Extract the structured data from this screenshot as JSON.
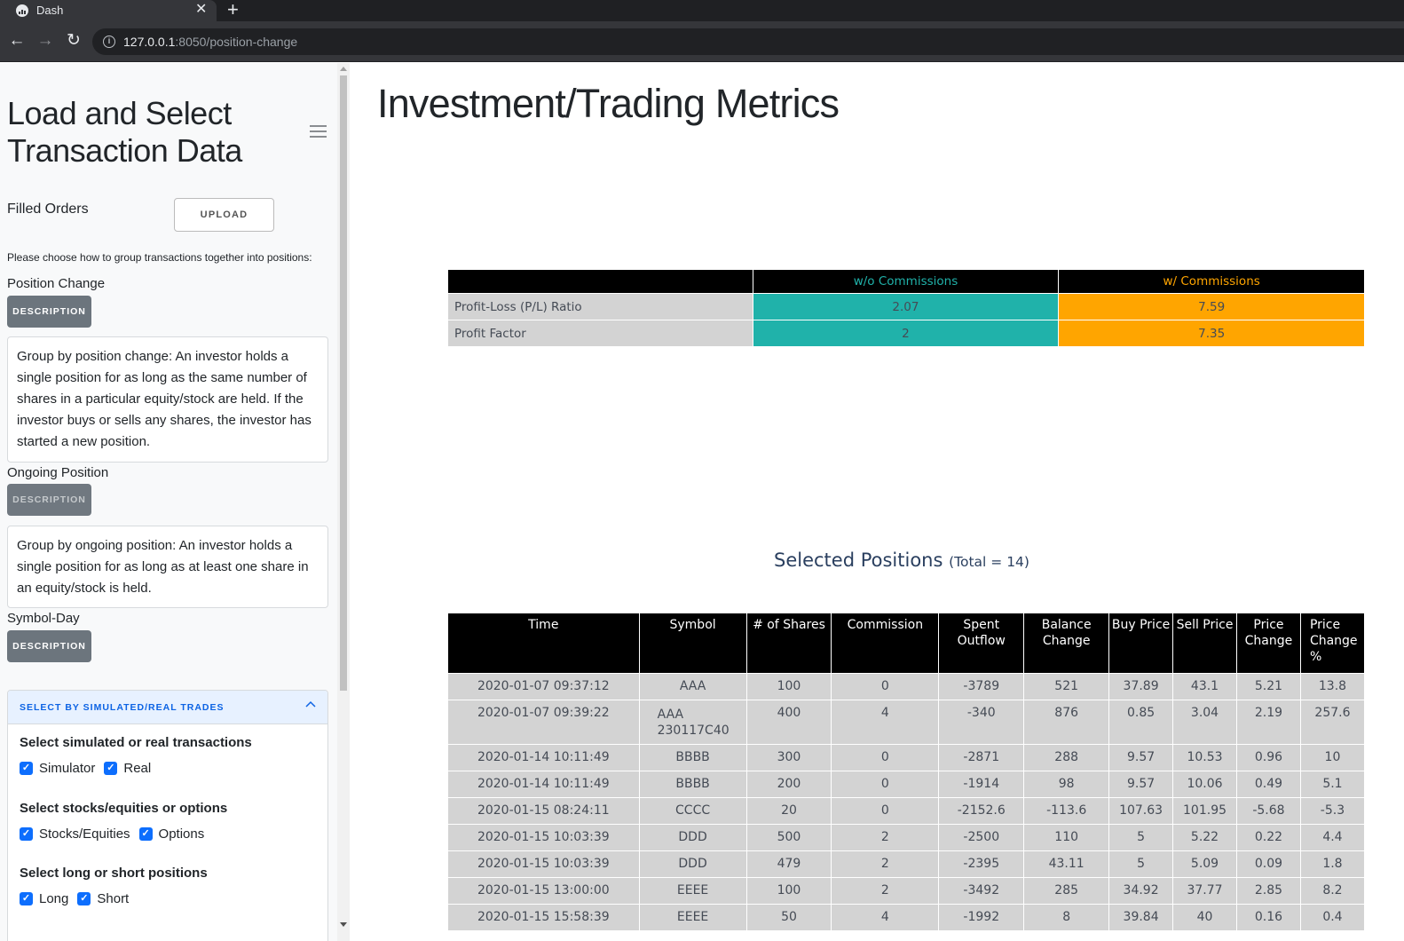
{
  "browser": {
    "tab_title": "Dash",
    "new_tab_symbol": "+",
    "close_symbol": "✕",
    "url_host": "127.0.0.1",
    "url_rest": ":8050/position-change"
  },
  "sidebar": {
    "title": "Load and Select Transaction Data",
    "filled_orders_label": "Filled Orders",
    "upload_label": "UPLOAD",
    "group_prompt": "Please choose how to group transactions together into positions:",
    "options": [
      {
        "label": "Position Change",
        "button": "DESCRIPTION",
        "description": "Group by position change: An investor holds a single position for as long as the same number of shares in a particular equity/stock are held. If the investor buys or sells any shares, the investor has started a new position."
      },
      {
        "label": "Ongoing Position",
        "button": "DESCRIPTION",
        "description": "Group by ongoing position: An investor holds a single position for as long as at least one share in an equity/stock is held."
      },
      {
        "label": "Symbol-Day",
        "button": "DESCRIPTION"
      }
    ],
    "accordion": {
      "title": "SELECT BY SIMULATED/REAL TRADES",
      "sections": [
        {
          "title": "Select simulated or real transactions",
          "checkboxes": [
            {
              "label": "Simulator",
              "checked": true
            },
            {
              "label": "Real",
              "checked": true
            }
          ]
        },
        {
          "title": "Select stocks/equities or options",
          "checkboxes": [
            {
              "label": "Stocks/Equities",
              "checked": true
            },
            {
              "label": "Options",
              "checked": true
            }
          ]
        },
        {
          "title": "Select long or short positions",
          "checkboxes": [
            {
              "label": "Long",
              "checked": true
            },
            {
              "label": "Short",
              "checked": true
            }
          ]
        }
      ]
    }
  },
  "main": {
    "title": "Investment/Trading Metrics",
    "metrics_table": {
      "headers": [
        "",
        "w/o Commissions",
        "w/ Commissions"
      ],
      "rows": [
        [
          "Profit-Loss (P/L) Ratio",
          "2.07",
          "7.59"
        ],
        [
          "Profit Factor",
          "2",
          "7.35"
        ]
      ],
      "colors": {
        "without": "#20b2aa",
        "with": "#ffa500"
      }
    },
    "selected_title": "Selected Positions",
    "selected_total": "(Total = 14)",
    "positions_table": {
      "headers": [
        "Time",
        "Symbol",
        "# of Shares",
        "Commission",
        "Spent Outflow",
        "Balance Change",
        "Buy Price",
        "Sell Price",
        "Price Change",
        "Price Change %"
      ],
      "rows": [
        [
          "2020-01-07 09:37:12",
          "AAA",
          "100",
          "0",
          "-3789",
          "521",
          "37.89",
          "43.1",
          "5.21",
          "13.8"
        ],
        [
          "2020-01-07 09:39:22",
          "AAA 230117C40",
          "400",
          "4",
          "-340",
          "876",
          "0.85",
          "3.04",
          "2.19",
          "257.6"
        ],
        [
          "2020-01-14 10:11:49",
          "BBBB",
          "300",
          "0",
          "-2871",
          "288",
          "9.57",
          "10.53",
          "0.96",
          "10"
        ],
        [
          "2020-01-14 10:11:49",
          "BBBB",
          "200",
          "0",
          "-1914",
          "98",
          "9.57",
          "10.06",
          "0.49",
          "5.1"
        ],
        [
          "2020-01-15 08:24:11",
          "CCCC",
          "20",
          "0",
          "-2152.6",
          "-113.6",
          "107.63",
          "101.95",
          "-5.68",
          "-5.3"
        ],
        [
          "2020-01-15 10:03:39",
          "DDD",
          "500",
          "2",
          "-2500",
          "110",
          "5",
          "5.22",
          "0.22",
          "4.4"
        ],
        [
          "2020-01-15 10:03:39",
          "DDD",
          "479",
          "2",
          "-2395",
          "43.11",
          "5",
          "5.09",
          "0.09",
          "1.8"
        ],
        [
          "2020-01-15 13:00:00",
          "EEEE",
          "100",
          "2",
          "-3492",
          "285",
          "34.92",
          "37.77",
          "2.85",
          "8.2"
        ],
        [
          "2020-01-15 15:58:39",
          "EEEE",
          "50",
          "4",
          "-1992",
          "8",
          "39.84",
          "40",
          "0.16",
          "0.4"
        ]
      ]
    }
  }
}
